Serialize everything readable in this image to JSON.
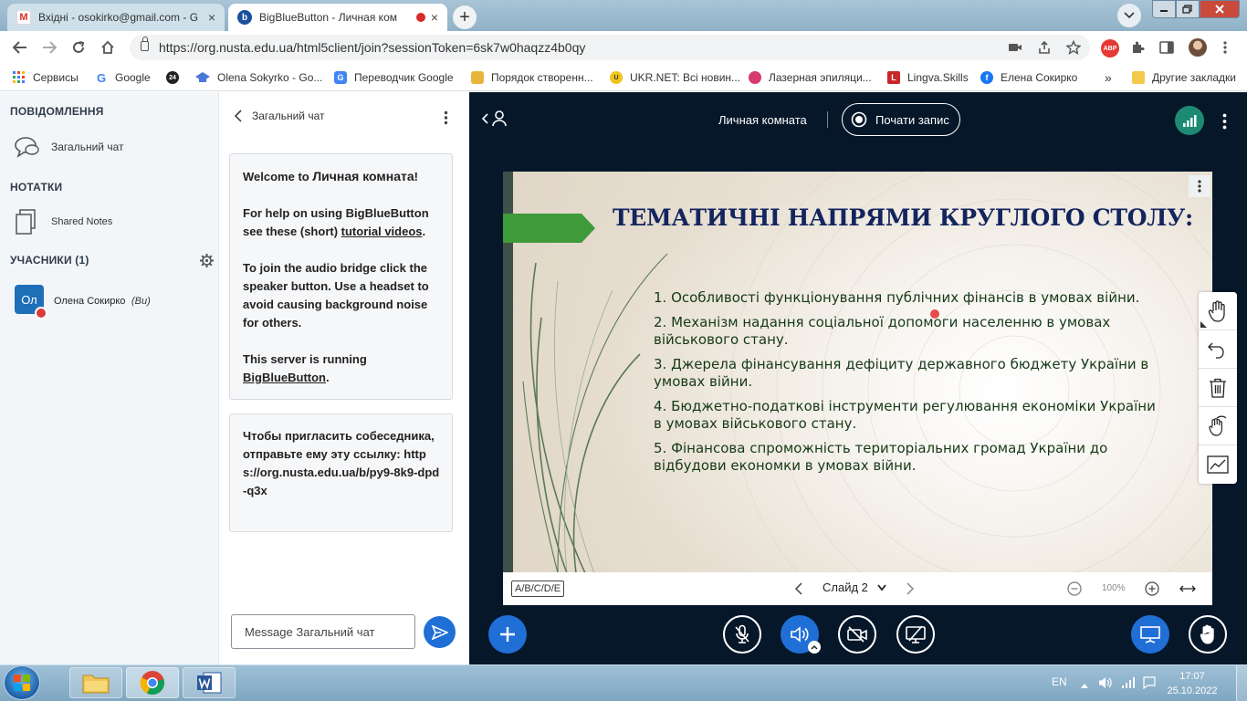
{
  "browser": {
    "tabs": [
      {
        "title": "Вхідні - osokirko@gmail.com - G",
        "close": "×"
      },
      {
        "title": "BigBlueButton - Личная ком",
        "close": "×"
      }
    ],
    "new_tab": "+",
    "url": "https://org.nusta.edu.ua/html5client/join?sessionToken=6sk7w0haqzz4b0qy",
    "abp_badge": "ABP",
    "bookmarks": [
      {
        "label": "Сервисы",
        "icon": "apps-grid-icon",
        "color": "#4285f4"
      },
      {
        "label": "Google",
        "icon": "google-icon",
        "color": "#4285f4"
      },
      {
        "label": "",
        "icon": "24-icon",
        "color": "#222222",
        "badge": "24"
      },
      {
        "label": "Olena Sokyrko - Go...",
        "icon": "scholar-icon",
        "color": "#4a78d9"
      },
      {
        "label": "Переводчик Google",
        "icon": "translate-icon",
        "color": "#4285f4"
      },
      {
        "label": "Порядок створенн...",
        "icon": "bookmark-page-icon",
        "color": "#e8b43a"
      },
      {
        "label": "UKR.NET: Всі новин...",
        "icon": "ukrnet-icon",
        "color": "#f0c419"
      },
      {
        "label": "Лазерная эпиляци...",
        "icon": "butterfly-icon",
        "color": "#d83a6e"
      },
      {
        "label": "Lingva.Skills",
        "icon": "lingva-icon",
        "color": "#c62828"
      },
      {
        "label": "Елена Сокирко",
        "icon": "facebook-icon",
        "color": "#1877f2"
      }
    ],
    "more_bookmarks": "»",
    "other_bookmarks": "Другие закладки"
  },
  "left_panel": {
    "messages_header": "ПОВІДОМЛЕННЯ",
    "public_chat": "Загальний чат",
    "notes_header": "НОТАТКИ",
    "shared_notes": "Shared Notes",
    "users_header": "УЧАСНИКИ (1)",
    "user": {
      "initials": "Ол",
      "name": "Олена Сокирко",
      "you": "(Ви)"
    }
  },
  "chat": {
    "title": "Загальний чат",
    "welcome_prefix": "Welcome to ",
    "welcome_room": "Личная комната",
    "welcome_suffix": "!",
    "help_1": "For help on using BigBlueButton see these (short) ",
    "help_link": "tutorial videos",
    "help_2": ".",
    "audio": "To join the audio bridge click the speaker button. Use a headset to avoid causing background noise for others.",
    "server_1": "This server is running ",
    "server_link": "BigBlueButton",
    "server_2": ".",
    "invite": "Чтобы пригласить собеседника, отправьте ему эту ссылку: https://org.nusta.edu.ua/b/py9-8k9-dpd-q3x",
    "input_placeholder": "Message Загальний чат"
  },
  "meeting": {
    "room_name": "Личная комната",
    "record_label": "Почати запис"
  },
  "slide": {
    "title": "ТЕМАТИЧНІ НАПРЯМИ КРУГЛОГО СТОЛУ:",
    "items": [
      "1. Особливості функціонування публічних фінансів в умовах війни.",
      "2. Механізм надання соціальної допомоги населенню в умовах військового стану.",
      "3. Джерела фінансування дефіциту державного бюджету України в умовах війни.",
      "4. Бюджетно-податкові інструменти регулювання економіки України в умовах військового стану.",
      "5. Фінансова спроможність територіальних громад України до відбудови економки в умовах війни."
    ]
  },
  "slide_controls": {
    "quick_poll": "A/B/C/D/E",
    "slide_label": "Слайд 2",
    "zoom": "100%"
  },
  "taskbar": {
    "lang": "EN",
    "time": "17:07",
    "date": "25.10.2022"
  }
}
